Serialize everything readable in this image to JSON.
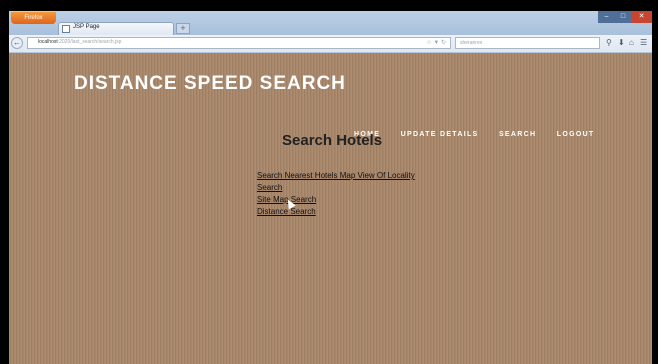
{
  "browser": {
    "app_button_label": "Firefox",
    "tab_title": "JSP Page",
    "new_tab_label": "+",
    "url_host": "localhost",
    "url_rest": ":2020/last_search/search.jsp",
    "search_placeholder": "sheranrex"
  },
  "site": {
    "title": "DISTANCE SPEED SEARCH",
    "menu": [
      "HOME",
      "UPDATE DETAILS",
      "SEARCH",
      "LOGOUT"
    ]
  },
  "main": {
    "heading": "Search Hotels",
    "links": [
      "Search Nearest Hotels Map View Of Locality",
      "Search",
      "Site Map Search",
      "Distance Search"
    ]
  }
}
